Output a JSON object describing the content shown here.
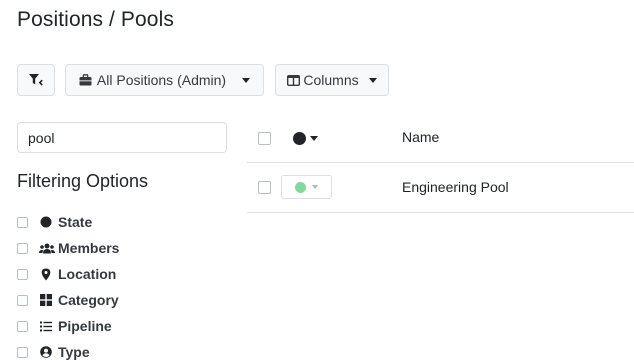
{
  "page": {
    "title": "Positions / Pools"
  },
  "toolbar": {
    "filter_toggle_icon": "filter-collapse-icon",
    "positions_dropdown": {
      "icon": "briefcase-icon",
      "label": "All Positions (Admin)"
    },
    "columns_dropdown": {
      "icon": "columns-icon",
      "label": "Columns"
    }
  },
  "search": {
    "value": "pool"
  },
  "filters": {
    "heading": "Filtering Options",
    "items": [
      {
        "label": "State",
        "icon": "circle-icon"
      },
      {
        "label": "Members",
        "icon": "users-icon"
      },
      {
        "label": "Location",
        "icon": "map-marker-icon"
      },
      {
        "label": "Category",
        "icon": "grid-icon"
      },
      {
        "label": "Pipeline",
        "icon": "list-icon"
      },
      {
        "label": "Type",
        "icon": "user-circle-icon"
      }
    ]
  },
  "table": {
    "columns": {
      "name": "Name"
    },
    "rows": [
      {
        "status_color": "#7ddc9a",
        "name": "Engineering Pool"
      }
    ]
  },
  "colors": {
    "status_header_dot": "#212529",
    "status_active": "#7ddc9a",
    "border": "#dee2e6"
  }
}
